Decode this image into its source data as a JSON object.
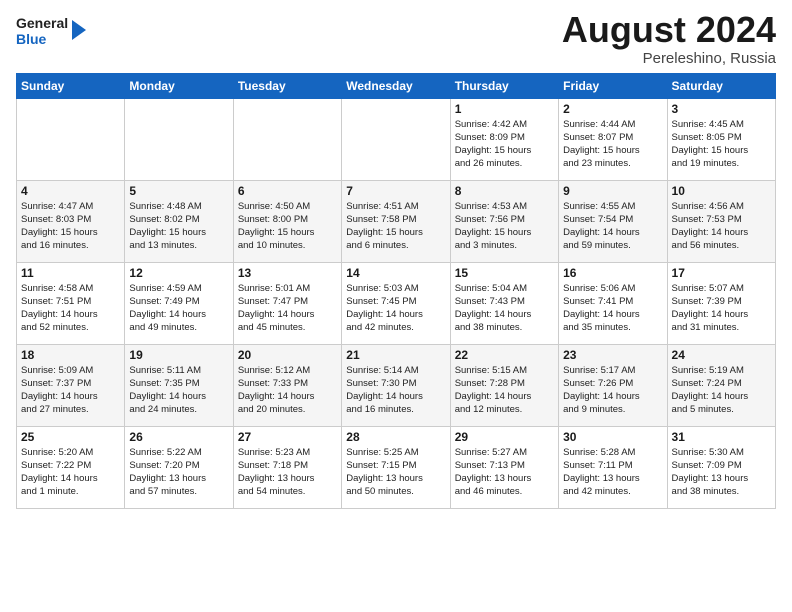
{
  "logo": {
    "line1": "General",
    "line2": "Blue",
    "icon": "▶"
  },
  "title": "August 2024",
  "location": "Pereleshino, Russia",
  "days_of_week": [
    "Sunday",
    "Monday",
    "Tuesday",
    "Wednesday",
    "Thursday",
    "Friday",
    "Saturday"
  ],
  "weeks": [
    [
      {
        "num": "",
        "info": ""
      },
      {
        "num": "",
        "info": ""
      },
      {
        "num": "",
        "info": ""
      },
      {
        "num": "",
        "info": ""
      },
      {
        "num": "1",
        "info": "Sunrise: 4:42 AM\nSunset: 8:09 PM\nDaylight: 15 hours\nand 26 minutes."
      },
      {
        "num": "2",
        "info": "Sunrise: 4:44 AM\nSunset: 8:07 PM\nDaylight: 15 hours\nand 23 minutes."
      },
      {
        "num": "3",
        "info": "Sunrise: 4:45 AM\nSunset: 8:05 PM\nDaylight: 15 hours\nand 19 minutes."
      }
    ],
    [
      {
        "num": "4",
        "info": "Sunrise: 4:47 AM\nSunset: 8:03 PM\nDaylight: 15 hours\nand 16 minutes."
      },
      {
        "num": "5",
        "info": "Sunrise: 4:48 AM\nSunset: 8:02 PM\nDaylight: 15 hours\nand 13 minutes."
      },
      {
        "num": "6",
        "info": "Sunrise: 4:50 AM\nSunset: 8:00 PM\nDaylight: 15 hours\nand 10 minutes."
      },
      {
        "num": "7",
        "info": "Sunrise: 4:51 AM\nSunset: 7:58 PM\nDaylight: 15 hours\nand 6 minutes."
      },
      {
        "num": "8",
        "info": "Sunrise: 4:53 AM\nSunset: 7:56 PM\nDaylight: 15 hours\nand 3 minutes."
      },
      {
        "num": "9",
        "info": "Sunrise: 4:55 AM\nSunset: 7:54 PM\nDaylight: 14 hours\nand 59 minutes."
      },
      {
        "num": "10",
        "info": "Sunrise: 4:56 AM\nSunset: 7:53 PM\nDaylight: 14 hours\nand 56 minutes."
      }
    ],
    [
      {
        "num": "11",
        "info": "Sunrise: 4:58 AM\nSunset: 7:51 PM\nDaylight: 14 hours\nand 52 minutes."
      },
      {
        "num": "12",
        "info": "Sunrise: 4:59 AM\nSunset: 7:49 PM\nDaylight: 14 hours\nand 49 minutes."
      },
      {
        "num": "13",
        "info": "Sunrise: 5:01 AM\nSunset: 7:47 PM\nDaylight: 14 hours\nand 45 minutes."
      },
      {
        "num": "14",
        "info": "Sunrise: 5:03 AM\nSunset: 7:45 PM\nDaylight: 14 hours\nand 42 minutes."
      },
      {
        "num": "15",
        "info": "Sunrise: 5:04 AM\nSunset: 7:43 PM\nDaylight: 14 hours\nand 38 minutes."
      },
      {
        "num": "16",
        "info": "Sunrise: 5:06 AM\nSunset: 7:41 PM\nDaylight: 14 hours\nand 35 minutes."
      },
      {
        "num": "17",
        "info": "Sunrise: 5:07 AM\nSunset: 7:39 PM\nDaylight: 14 hours\nand 31 minutes."
      }
    ],
    [
      {
        "num": "18",
        "info": "Sunrise: 5:09 AM\nSunset: 7:37 PM\nDaylight: 14 hours\nand 27 minutes."
      },
      {
        "num": "19",
        "info": "Sunrise: 5:11 AM\nSunset: 7:35 PM\nDaylight: 14 hours\nand 24 minutes."
      },
      {
        "num": "20",
        "info": "Sunrise: 5:12 AM\nSunset: 7:33 PM\nDaylight: 14 hours\nand 20 minutes."
      },
      {
        "num": "21",
        "info": "Sunrise: 5:14 AM\nSunset: 7:30 PM\nDaylight: 14 hours\nand 16 minutes."
      },
      {
        "num": "22",
        "info": "Sunrise: 5:15 AM\nSunset: 7:28 PM\nDaylight: 14 hours\nand 12 minutes."
      },
      {
        "num": "23",
        "info": "Sunrise: 5:17 AM\nSunset: 7:26 PM\nDaylight: 14 hours\nand 9 minutes."
      },
      {
        "num": "24",
        "info": "Sunrise: 5:19 AM\nSunset: 7:24 PM\nDaylight: 14 hours\nand 5 minutes."
      }
    ],
    [
      {
        "num": "25",
        "info": "Sunrise: 5:20 AM\nSunset: 7:22 PM\nDaylight: 14 hours\nand 1 minute."
      },
      {
        "num": "26",
        "info": "Sunrise: 5:22 AM\nSunset: 7:20 PM\nDaylight: 13 hours\nand 57 minutes."
      },
      {
        "num": "27",
        "info": "Sunrise: 5:23 AM\nSunset: 7:18 PM\nDaylight: 13 hours\nand 54 minutes."
      },
      {
        "num": "28",
        "info": "Sunrise: 5:25 AM\nSunset: 7:15 PM\nDaylight: 13 hours\nand 50 minutes."
      },
      {
        "num": "29",
        "info": "Sunrise: 5:27 AM\nSunset: 7:13 PM\nDaylight: 13 hours\nand 46 minutes."
      },
      {
        "num": "30",
        "info": "Sunrise: 5:28 AM\nSunset: 7:11 PM\nDaylight: 13 hours\nand 42 minutes."
      },
      {
        "num": "31",
        "info": "Sunrise: 5:30 AM\nSunset: 7:09 PM\nDaylight: 13 hours\nand 38 minutes."
      }
    ]
  ]
}
